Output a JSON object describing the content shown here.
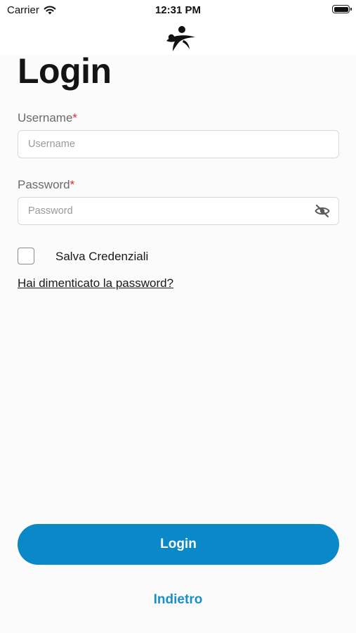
{
  "status_bar": {
    "carrier": "Carrier",
    "time": "12:31 PM",
    "wifi_icon": "wifi-icon",
    "battery_icon": "battery-icon"
  },
  "header": {
    "logo_icon": "app-logo"
  },
  "page": {
    "title": "Login"
  },
  "form": {
    "username": {
      "label": "Username",
      "required_mark": "*",
      "placeholder": "Username",
      "value": ""
    },
    "password": {
      "label": "Password",
      "required_mark": "*",
      "placeholder": "Password",
      "value": "",
      "toggle_icon": "eye-slash-icon"
    },
    "save_credentials": {
      "label": "Salva Credenziali",
      "checked": false
    },
    "forgot_password": "Hai dimenticato la password?"
  },
  "actions": {
    "login_label": "Login",
    "back_label": "Indietro"
  },
  "colors": {
    "primary": "#0a88c7",
    "link": "#1a8fcb",
    "required": "#e0263b",
    "background": "#fbfbfb"
  }
}
